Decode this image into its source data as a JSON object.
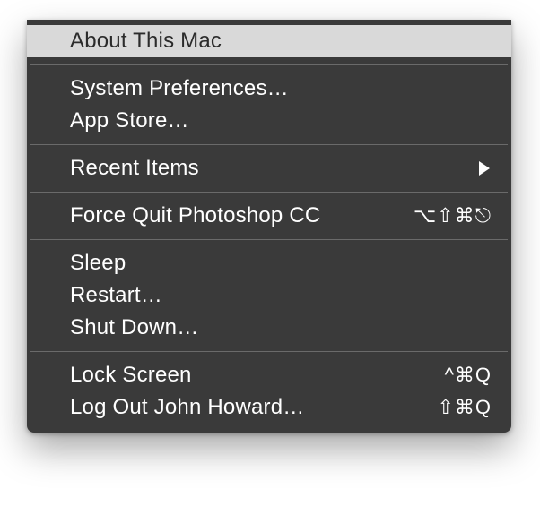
{
  "menu": {
    "about": {
      "label": "About This Mac"
    },
    "sysprefs": {
      "label": "System Preferences…"
    },
    "appstore": {
      "label": "App Store…"
    },
    "recent": {
      "label": "Recent Items"
    },
    "forcequit": {
      "label": "Force Quit Photoshop CC",
      "shortcut": "⌥⇧⌘⎋"
    },
    "sleep": {
      "label": "Sleep"
    },
    "restart": {
      "label": "Restart…"
    },
    "shutdown": {
      "label": "Shut Down…"
    },
    "lockscreen": {
      "label": "Lock Screen",
      "shortcut": "^⌘Q"
    },
    "logout": {
      "label": "Log Out John Howard…",
      "shortcut": "⇧⌘Q"
    }
  }
}
